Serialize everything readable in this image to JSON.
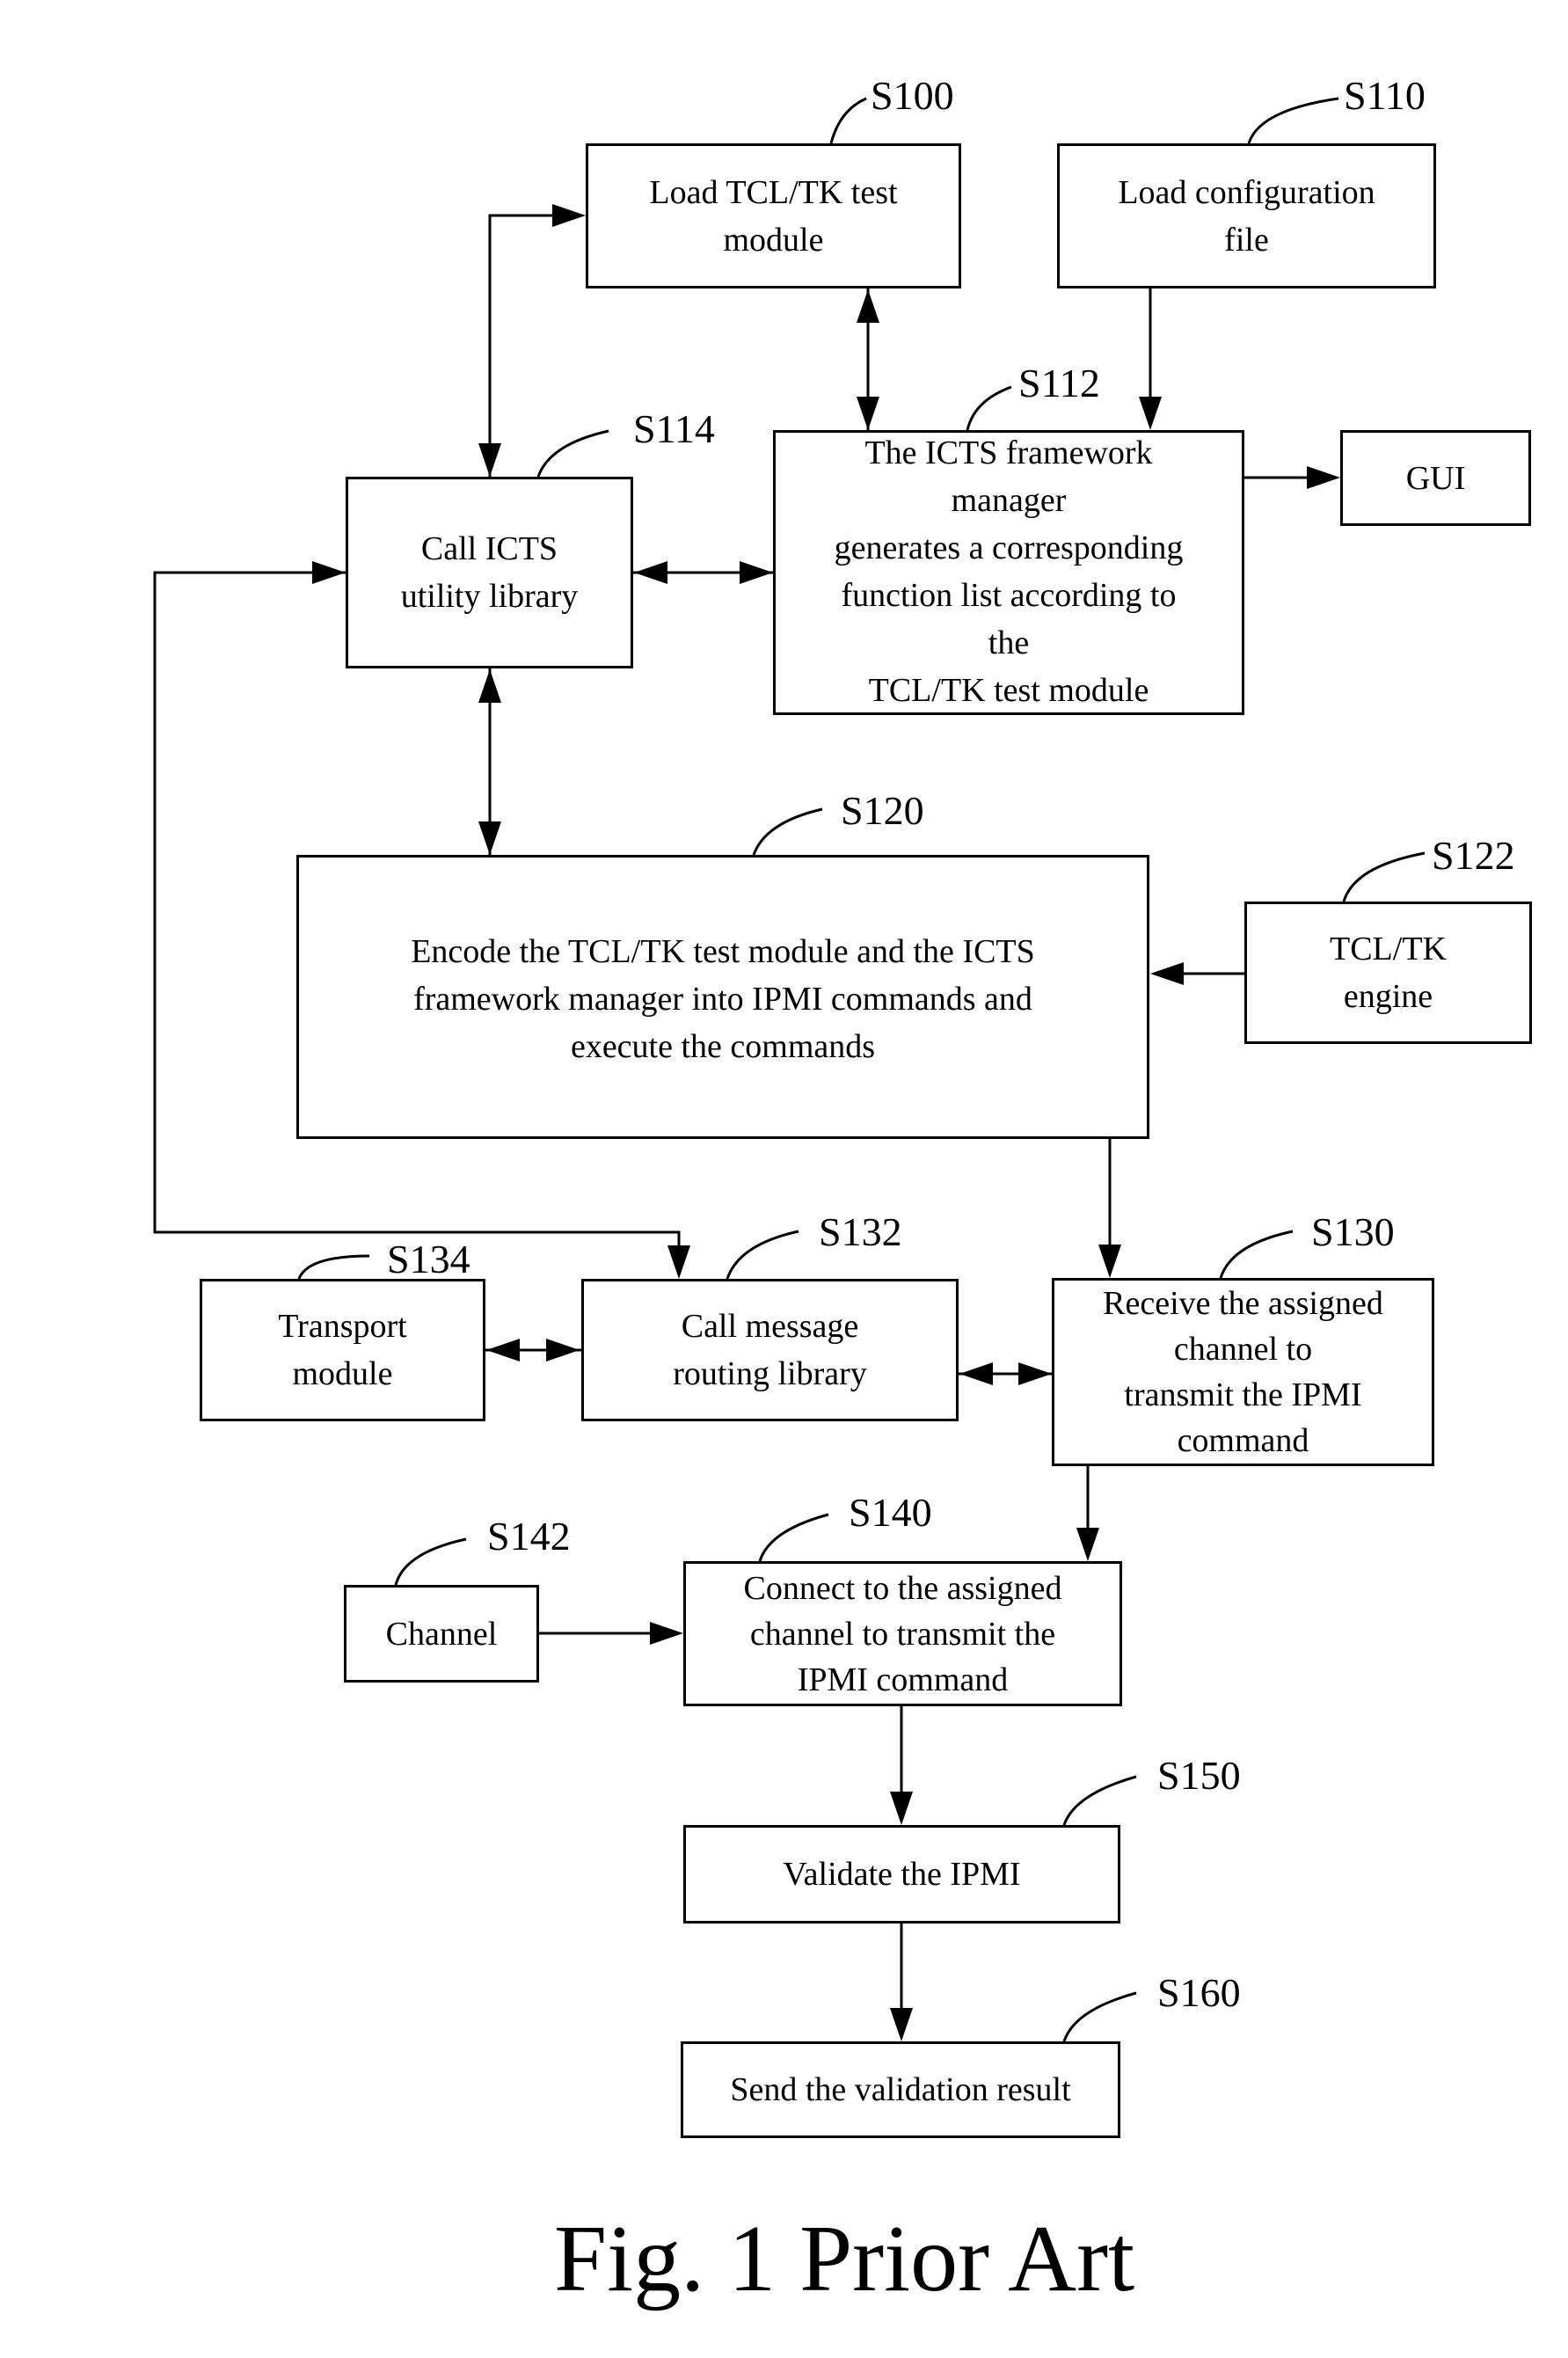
{
  "figure": {
    "caption": "Fig. 1 Prior Art",
    "steps": {
      "s100": {
        "id": "S100",
        "text": "Load TCL/TK test\nmodule"
      },
      "s110": {
        "id": "S110",
        "text": "Load configuration\nfile"
      },
      "s112": {
        "id": "S112",
        "text": "The ICTS framework\nmanager\ngenerates a corresponding\nfunction list according to\nthe\nTCL/TK test module"
      },
      "gui": {
        "text": "GUI"
      },
      "s114": {
        "id": "S114",
        "text": "Call ICTS\nutility library"
      },
      "s120": {
        "id": "S120",
        "text": "Encode the TCL/TK test module and the ICTS\nframework manager into IPMI commands and\nexecute the commands"
      },
      "s122": {
        "id": "S122",
        "text": "TCL/TK\nengine"
      },
      "s130": {
        "id": "S130",
        "text": "Receive the assigned\nchannel to\ntransmit the IPMI\ncommand"
      },
      "s132": {
        "id": "S132",
        "text": "Call message\nrouting library"
      },
      "s134": {
        "id": "S134",
        "text": "Transport\nmodule"
      },
      "s140": {
        "id": "S140",
        "text": "Connect to the assigned\nchannel to transmit the\nIPMI command"
      },
      "s142": {
        "id": "S142",
        "text": "Channel"
      },
      "s150": {
        "id": "S150",
        "text": "Validate the IPMI"
      },
      "s160": {
        "id": "S160",
        "text": "Send the validation result"
      }
    }
  }
}
